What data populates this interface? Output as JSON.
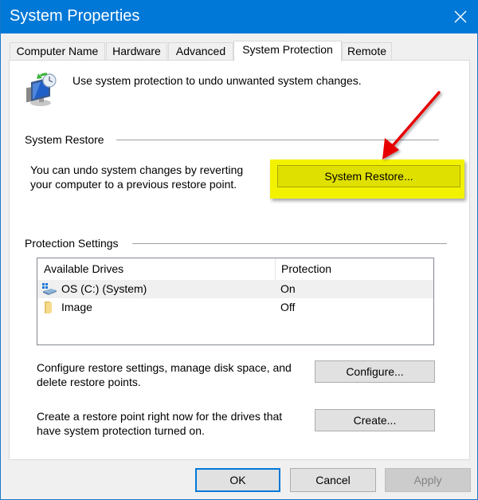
{
  "window": {
    "title": "System Properties",
    "close_icon": "close-icon"
  },
  "tabs": [
    {
      "label": "Computer Name",
      "active": false
    },
    {
      "label": "Hardware",
      "active": false
    },
    {
      "label": "Advanced",
      "active": false
    },
    {
      "label": "System Protection",
      "active": true
    },
    {
      "label": "Remote",
      "active": false
    }
  ],
  "intro": {
    "icon": "system-protection-icon",
    "text": "Use system protection to undo unwanted system changes."
  },
  "system_restore": {
    "group_label": "System Restore",
    "description_line1": "You can undo system changes by reverting",
    "description_line2": "your computer to a previous restore point.",
    "button_label": "System Restore...",
    "highlight_color": "#f2f200",
    "annotation_arrow_color": "#e60000"
  },
  "protection_settings": {
    "group_label": "Protection Settings",
    "columns": [
      "Available Drives",
      "Protection"
    ],
    "drives": [
      {
        "name": "OS (C:) (System)",
        "protection": "On",
        "icon": "system-drive-icon",
        "selected": true
      },
      {
        "name": "Image",
        "protection": "Off",
        "icon": "folder-icon",
        "selected": false
      }
    ],
    "configure_text_line1": "Configure restore settings, manage disk space, and",
    "configure_text_line2": "delete restore points.",
    "configure_button": "Configure...",
    "create_text_line1": "Create a restore point right now for the drives that",
    "create_text_line2": "have system protection turned on.",
    "create_button": "Create..."
  },
  "footer": {
    "ok": "OK",
    "cancel": "Cancel",
    "apply": "Apply",
    "apply_disabled": true
  }
}
